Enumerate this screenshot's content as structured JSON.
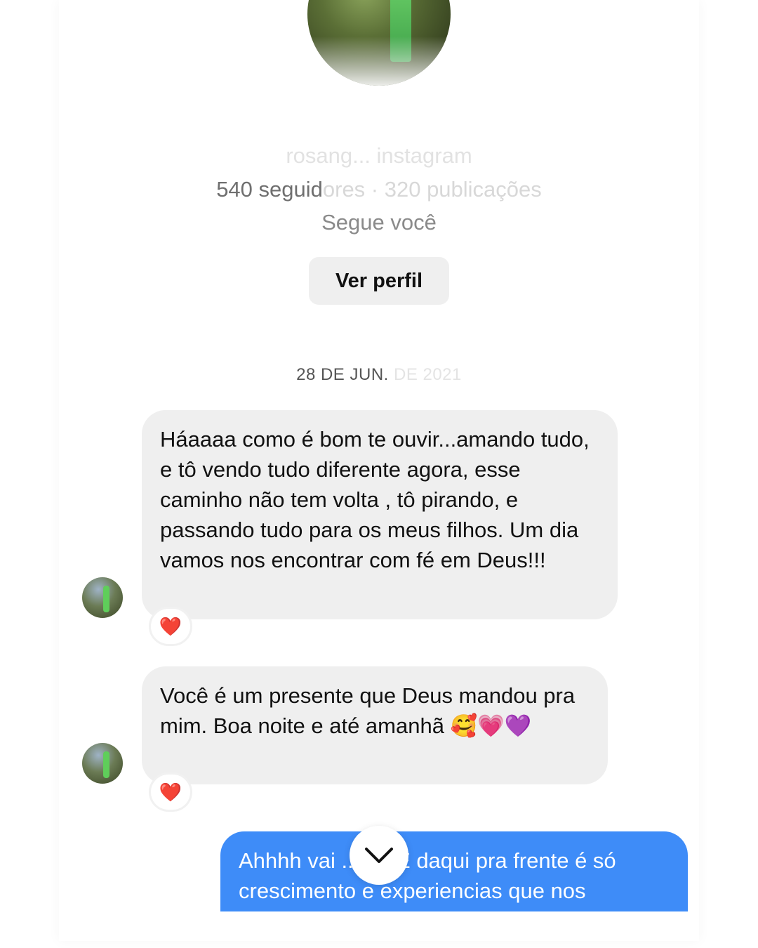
{
  "profile": {
    "username": "rosang... instagram",
    "stats_visible": "540 seguid",
    "stats_faded": "ores · 320 publicações",
    "follows_you": "Segue você",
    "view_profile_label": "Ver perfil"
  },
  "thread": {
    "date_visible": "28 DE JUN.",
    "date_faded": " DE 2021"
  },
  "messages": [
    {
      "direction": "incoming",
      "text": "Háaaaa como é bom te ouvir...amando tudo, e tô vendo tudo diferente agora, esse caminho não tem volta , tô pirando, e passando tudo para os meus filhos. Um dia vamos nos encontrar com fé em Deus!!!",
      "reaction": "❤️"
    },
    {
      "direction": "incoming",
      "text": "Você é um presente que Deus mandou pra mim. Boa noite e até amanhã 🥰💗💜",
      "reaction": "❤️"
    },
    {
      "direction": "outgoing",
      "text": "Ahhhh vai ...o!!! E daqui pra frente é só crescimento e experiencias que nos"
    }
  ],
  "colors": {
    "incoming_bubble": "#efefef",
    "outgoing_bubble": "#3e8cf8",
    "button_bg": "#efefef"
  },
  "icons": {
    "scroll_down": "chevron-down-icon",
    "reaction": "heart-icon"
  }
}
